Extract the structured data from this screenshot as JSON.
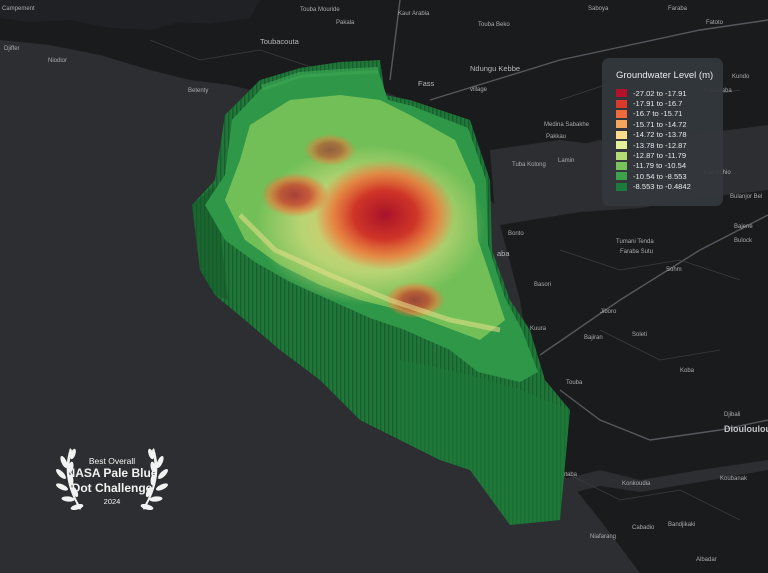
{
  "map": {
    "labels": [
      {
        "text": "Campement",
        "size": "s"
      },
      {
        "text": "Djiffer",
        "size": "s"
      },
      {
        "text": "Niodior",
        "size": "s"
      },
      {
        "text": "Toubacouta",
        "size": "mid"
      },
      {
        "text": "Betenty",
        "size": "s"
      },
      {
        "text": "Touba Mouride",
        "size": "s"
      },
      {
        "text": "Pakala",
        "size": "s"
      },
      {
        "text": "Kaur Arabia",
        "size": "s"
      },
      {
        "text": "Touba Beko",
        "size": "s"
      },
      {
        "text": "Saboya",
        "size": "s"
      },
      {
        "text": "Faraba",
        "size": "s"
      },
      {
        "text": "Fatoto",
        "size": "s"
      },
      {
        "text": "Fass",
        "size": "mid"
      },
      {
        "text": "Ndungu Kebbe",
        "size": "mid"
      },
      {
        "text": "Farang Poste",
        "size": "s"
      },
      {
        "text": "Medina Sabakhe",
        "size": "s"
      },
      {
        "text": "Pakkau",
        "size": "s"
      },
      {
        "text": "Tuba Kolong",
        "size": "s"
      },
      {
        "text": "Lamin",
        "size": "s"
      },
      {
        "text": "Karantaba",
        "size": "s"
      },
      {
        "text": "Kundo",
        "size": "s"
      },
      {
        "text": "Kandiohio",
        "size": "s"
      },
      {
        "text": "Bulanjor Bel",
        "size": "s"
      },
      {
        "text": "Bajene",
        "size": "s"
      },
      {
        "text": "Bulock",
        "size": "s"
      },
      {
        "text": "Tumani Tenda",
        "size": "s"
      },
      {
        "text": "Faraba Sutu",
        "size": "s"
      },
      {
        "text": "Sohm",
        "size": "s"
      },
      {
        "text": "Bonto",
        "size": "s"
      },
      {
        "text": "aba",
        "size": "mid"
      },
      {
        "text": "Basori",
        "size": "s"
      },
      {
        "text": "Jiboro",
        "size": "s"
      },
      {
        "text": "Bajiran",
        "size": "s"
      },
      {
        "text": "Soleti",
        "size": "s"
      },
      {
        "text": "Kuura",
        "size": "s"
      },
      {
        "text": "Koba",
        "size": "s"
      },
      {
        "text": "Touba",
        "size": "s"
      },
      {
        "text": "Djibali",
        "size": "s"
      },
      {
        "text": "Diouloulou",
        "size": "big"
      },
      {
        "text": "Koubanak",
        "size": "s"
      },
      {
        "text": "Konkoudia",
        "size": "s"
      },
      {
        "text": "ntaba",
        "size": "s"
      },
      {
        "text": "Bandjikaki",
        "size": "s"
      },
      {
        "text": "Cabadio",
        "size": "s"
      },
      {
        "text": "Niafarang",
        "size": "s"
      },
      {
        "text": "Albadar",
        "size": "s"
      },
      {
        "text": "village",
        "size": "s"
      }
    ]
  },
  "legend": {
    "title": "Groundwater Level (m)",
    "items": [
      {
        "label": "-27.02 to -17.91",
        "color": "#b5112a"
      },
      {
        "label": "-17.91 to -16.7",
        "color": "#d93a2a"
      },
      {
        "label": "-16.7 to -15.71",
        "color": "#ef6b3b"
      },
      {
        "label": "-15.71 to -14.72",
        "color": "#f7a45c"
      },
      {
        "label": "-14.72 to -13.78",
        "color": "#fbdb8c"
      },
      {
        "label": "-13.78 to -12.87",
        "color": "#e4f19a"
      },
      {
        "label": "-12.87 to -11.79",
        "color": "#b3dc72"
      },
      {
        "label": "-11.79 to -10.54",
        "color": "#77c259"
      },
      {
        "label": "-10.54 to -8.553",
        "color": "#3da34b"
      },
      {
        "label": "-8.553 to -0.4842",
        "color": "#1a7b3c"
      }
    ]
  },
  "badge": {
    "top": "Best Overall",
    "line1": "NASA Pale Blue",
    "line2": "Dot Challenge",
    "year": "2024"
  }
}
